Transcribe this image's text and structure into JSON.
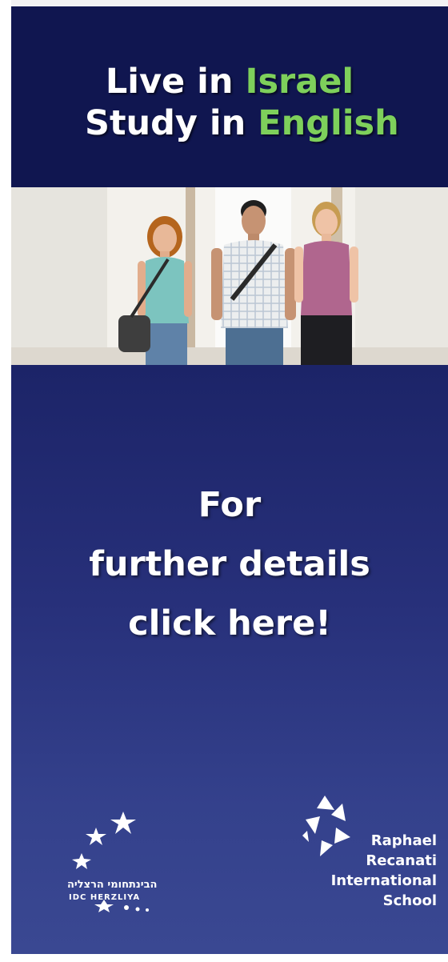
{
  "headline": {
    "line1_prefix": "Live in ",
    "line1_accent": "Israel",
    "line2_prefix": "Study in ",
    "line2_accent": "English"
  },
  "cta": {
    "line1": "For",
    "line2": "further details",
    "line3": "click here!"
  },
  "logos": {
    "idc_hebrew": "הבינתחומי הרצליה",
    "idc_english": "IDC HERZLIYA",
    "recanati_lines": [
      "Raphael",
      "Recanati",
      "International",
      "School"
    ]
  },
  "colors": {
    "headline_bg": "#101650",
    "accent_green": "#7ed05b",
    "cta_bg": "#27307a",
    "text": "#ffffff"
  },
  "icons": {
    "idc_mark": "stars-arc-icon",
    "recanati_mark": "triangle-star-icon"
  }
}
